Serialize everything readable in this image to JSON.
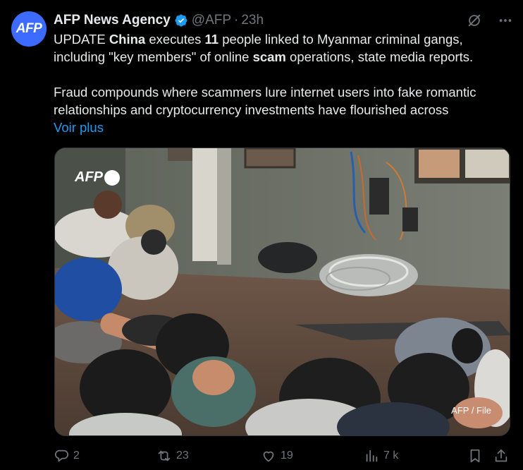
{
  "author": {
    "avatar_text": "AFP",
    "name": "AFP News Agency",
    "handle": "@AFP",
    "separator": "·",
    "time": "23h",
    "verified_icon": "verified-badge-icon"
  },
  "tweet": {
    "line1_pre": "UPDATE ",
    "line1_b1": "China",
    "line1_mid": " executes ",
    "line1_b2": "11",
    "line1_post": " people linked to Myanmar criminal gangs,",
    "line2_pre": "including \"key members\" of online ",
    "line2_b": "scam",
    "line2_post": " operations, state media reports.",
    "para2_line1": "Fraud compounds where scammers lure internet users into fake romantic",
    "para2_line2": "relationships and cryptocurrency investments have flourished across",
    "show_more": "Voir plus"
  },
  "media": {
    "watermark": "AFP",
    "credit": "AFP / File"
  },
  "actions": {
    "replies": "2",
    "reposts": "23",
    "likes": "19",
    "views": "7 k"
  },
  "colors": {
    "background": "#000000",
    "text": "#e7e9ea",
    "muted": "#71767b",
    "link": "#1d9bf0",
    "avatar": "#3d6bff"
  }
}
